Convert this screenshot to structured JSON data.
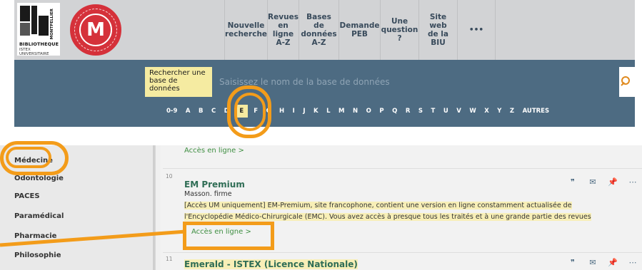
{
  "header": {
    "logo_title": "BIBLIOTHEQUE",
    "logo_subtitle": "ISTEX UNIVERSITAIRE",
    "logo_vertical": "MONTPELLIER",
    "seal_letter": "M",
    "nav": [
      {
        "lines": [
          "Nouvelle",
          "recherche"
        ]
      },
      {
        "lines": [
          "Revues",
          "en ligne",
          "A-Z"
        ]
      },
      {
        "lines": [
          "Bases de",
          "données",
          "A-Z"
        ]
      },
      {
        "lines": [
          "Demande",
          "PEB"
        ]
      },
      {
        "lines": [
          "Une",
          "question",
          "?"
        ]
      },
      {
        "lines": [
          "Site web",
          "de la BIU"
        ]
      },
      {
        "lines": [
          "•••"
        ]
      }
    ]
  },
  "search": {
    "label": "Rechercher une base de données",
    "placeholder": "Saisissez le nom de la base de données"
  },
  "alphabet": {
    "letters": [
      "0-9",
      "A",
      "B",
      "C",
      "D",
      "E",
      "F",
      "G",
      "H",
      "I",
      "J",
      "K",
      "L",
      "M",
      "N",
      "O",
      "P",
      "Q",
      "R",
      "S",
      "T",
      "U",
      "V",
      "W",
      "X",
      "Y",
      "Z",
      "AUTRES"
    ],
    "active": "E"
  },
  "sidebar": {
    "items": [
      "Médecine",
      "Odontologie",
      "PACES",
      "Paramédical",
      "Pharmacie",
      "Philosophie"
    ]
  },
  "results": {
    "prev_access": "Accès en ligne  >",
    "item10": {
      "rank": "10",
      "title": "EM Premium",
      "publisher": "Masson. firme",
      "desc_line1": "[Accès UM uniquement] EM-Premium, site francophone, contient une version en ligne constamment actualisée de",
      "desc_line2": "l'Encyclopédie Médico-Chirurgicale (EMC). Vous avez accès à presque tous les traités et à une grande partie des revues",
      "access": "Accès en ligne  >"
    },
    "item11": {
      "rank": "11",
      "title": "Emerald - ISTEX (Licence Nationale)"
    },
    "icons": [
      "quote-icon",
      "mail-icon",
      "pin-icon",
      "more-icon"
    ]
  },
  "colors": {
    "accent_orange": "#f39c1a",
    "band_blue": "#4d6b82",
    "highlight_yellow": "#f6eaa0",
    "link_green": "#3e8e41"
  }
}
